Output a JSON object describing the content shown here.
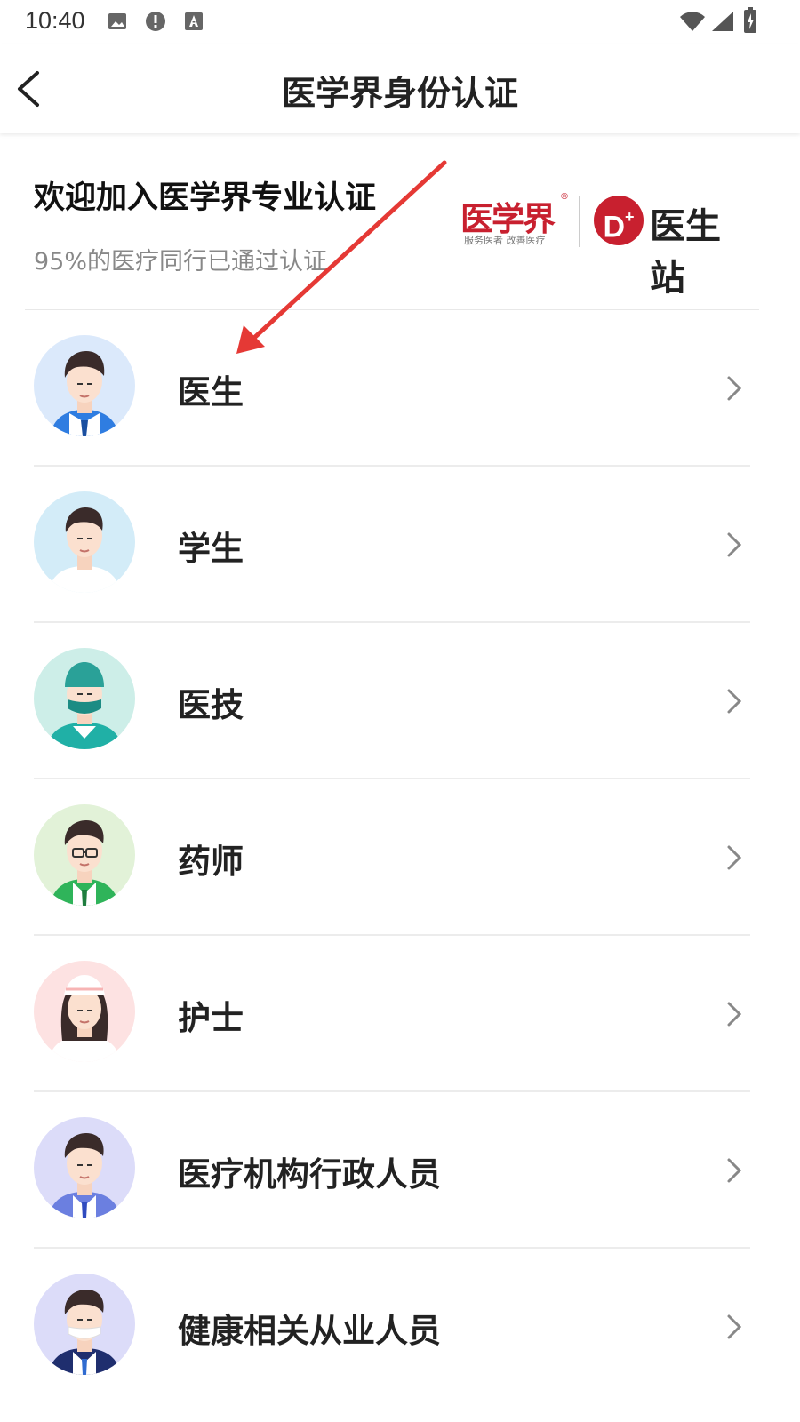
{
  "status_bar": {
    "time": "10:40",
    "left_icons": [
      "image-icon",
      "alert-icon",
      "text-icon"
    ],
    "right_icons": [
      "wifi-icon",
      "signal-icon",
      "battery-icon"
    ]
  },
  "header": {
    "title": "医学界身份认证",
    "back_icon": "back-arrow-icon"
  },
  "intro": {
    "title": "欢迎加入医学界专业认证",
    "subtitle": "95%的医疗同行已通过认证"
  },
  "logo": {
    "brand1": "医学界",
    "brand1_sub": "服务医者 改善医疗",
    "brand1_mark": "®",
    "brand2_badge": "D",
    "brand2_badge_sup": "+",
    "brand2": "医生站",
    "brand_color": "#c8202f"
  },
  "roles": [
    {
      "label": "医生",
      "avatar": "doctor-avatar",
      "bg": "#dbe9fb"
    },
    {
      "label": "学生",
      "avatar": "student-avatar",
      "bg": "#d3ecf8"
    },
    {
      "label": "医技",
      "avatar": "technician-avatar",
      "bg": "#cdeee8"
    },
    {
      "label": "药师",
      "avatar": "pharmacist-avatar",
      "bg": "#e2f2d8"
    },
    {
      "label": "护士",
      "avatar": "nurse-avatar",
      "bg": "#fde2e2"
    },
    {
      "label": "医疗机构行政人员",
      "avatar": "admin-avatar",
      "bg": "#dcdcf9"
    },
    {
      "label": "健康相关从业人员",
      "avatar": "health-worker-avatar",
      "bg": "#dcdcf9"
    }
  ],
  "annotation": {
    "color": "#e53935",
    "icon": "red-arrow-icon"
  }
}
